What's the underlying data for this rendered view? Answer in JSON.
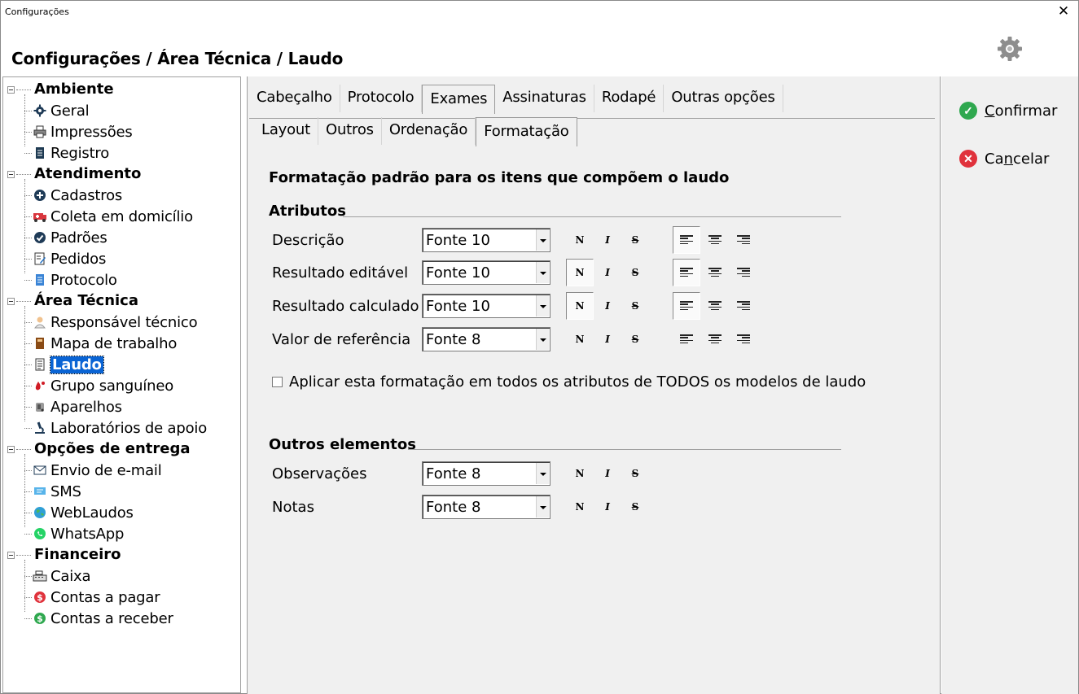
{
  "window": {
    "title": "Configurações",
    "close_glyph": "✕"
  },
  "header": {
    "heading": "Configurações / Área Técnica / Laudo",
    "icon": "gear-icon"
  },
  "sidebar": {
    "groups": [
      {
        "label": "Ambiente",
        "items": [
          {
            "label": "Geral",
            "icon": "gear-icon"
          },
          {
            "label": "Impressões",
            "icon": "printer-icon"
          },
          {
            "label": "Registro",
            "icon": "document-icon"
          }
        ]
      },
      {
        "label": "Atendimento",
        "items": [
          {
            "label": "Cadastros",
            "icon": "plus-circle-icon"
          },
          {
            "label": "Coleta em domicílio",
            "icon": "ambulance-icon"
          },
          {
            "label": "Padrões",
            "icon": "check-circle-icon"
          },
          {
            "label": "Pedidos",
            "icon": "edit-form-icon"
          },
          {
            "label": "Protocolo",
            "icon": "document-blue-icon"
          }
        ]
      },
      {
        "label": "Área Técnica",
        "items": [
          {
            "label": "Responsável técnico",
            "icon": "person-icon"
          },
          {
            "label": "Mapa de trabalho",
            "icon": "book-icon"
          },
          {
            "label": "Laudo",
            "icon": "report-icon",
            "selected": true
          },
          {
            "label": "Grupo sanguíneo",
            "icon": "blood-drop-icon"
          },
          {
            "label": "Aparelhos",
            "icon": "device-icon"
          },
          {
            "label": "Laboratórios de apoio",
            "icon": "microscope-icon"
          }
        ]
      },
      {
        "label": "Opções de entrega",
        "items": [
          {
            "label": "Envio de e-mail",
            "icon": "envelope-icon"
          },
          {
            "label": "SMS",
            "icon": "sms-icon"
          },
          {
            "label": "WebLaudos",
            "icon": "globe-icon"
          },
          {
            "label": "WhatsApp",
            "icon": "whatsapp-icon"
          }
        ]
      },
      {
        "label": "Financeiro",
        "items": [
          {
            "label": "Caixa",
            "icon": "cash-register-icon"
          },
          {
            "label": "Contas a pagar",
            "icon": "dollar-red-icon"
          },
          {
            "label": "Contas a receber",
            "icon": "dollar-green-icon"
          }
        ]
      }
    ]
  },
  "tabs_top": [
    "Cabeçalho",
    "Protocolo",
    "Exames",
    "Assinaturas",
    "Rodapé",
    "Outras opções"
  ],
  "tabs_top_active": "Exames",
  "tabs_sub": [
    "Layout",
    "Outros",
    "Ordenação",
    "Formatação"
  ],
  "tabs_sub_active": "Formatação",
  "content": {
    "heading": "Formatação padrão para os itens que compõem o laudo",
    "attributes_title": "Atributos",
    "attributes": [
      {
        "label": "Descrição",
        "font": "Fonte 10",
        "bold_pressed": false,
        "align_left_pressed": true
      },
      {
        "label": "Resultado editável",
        "font": "Fonte 10",
        "bold_pressed": true,
        "align_left_pressed": true
      },
      {
        "label": "Resultado calculado",
        "font": "Fonte 10",
        "bold_pressed": true,
        "align_left_pressed": true
      },
      {
        "label": "Valor de referência",
        "font": "Fonte 8",
        "bold_pressed": false,
        "align_left_pressed": false
      }
    ],
    "apply_all_label": "Aplicar esta formatação em todos os atributos de TODOS os modelos de laudo",
    "apply_all_checked": false,
    "others_title": "Outros elementos",
    "others": [
      {
        "label": "Observações",
        "font": "Fonte 8"
      },
      {
        "label": "Notas",
        "font": "Fonte 8"
      }
    ],
    "format_glyphs": {
      "bold": "N",
      "italic": "I",
      "strike": "S"
    }
  },
  "actions": {
    "confirm": {
      "label_prefix": "",
      "label_mnemonic": "C",
      "label_rest": "onfirmar",
      "color": "#2fa84f"
    },
    "cancel": {
      "label_prefix": "Ca",
      "label_mnemonic": "n",
      "label_rest": "celar",
      "color": "#e0323c"
    }
  }
}
